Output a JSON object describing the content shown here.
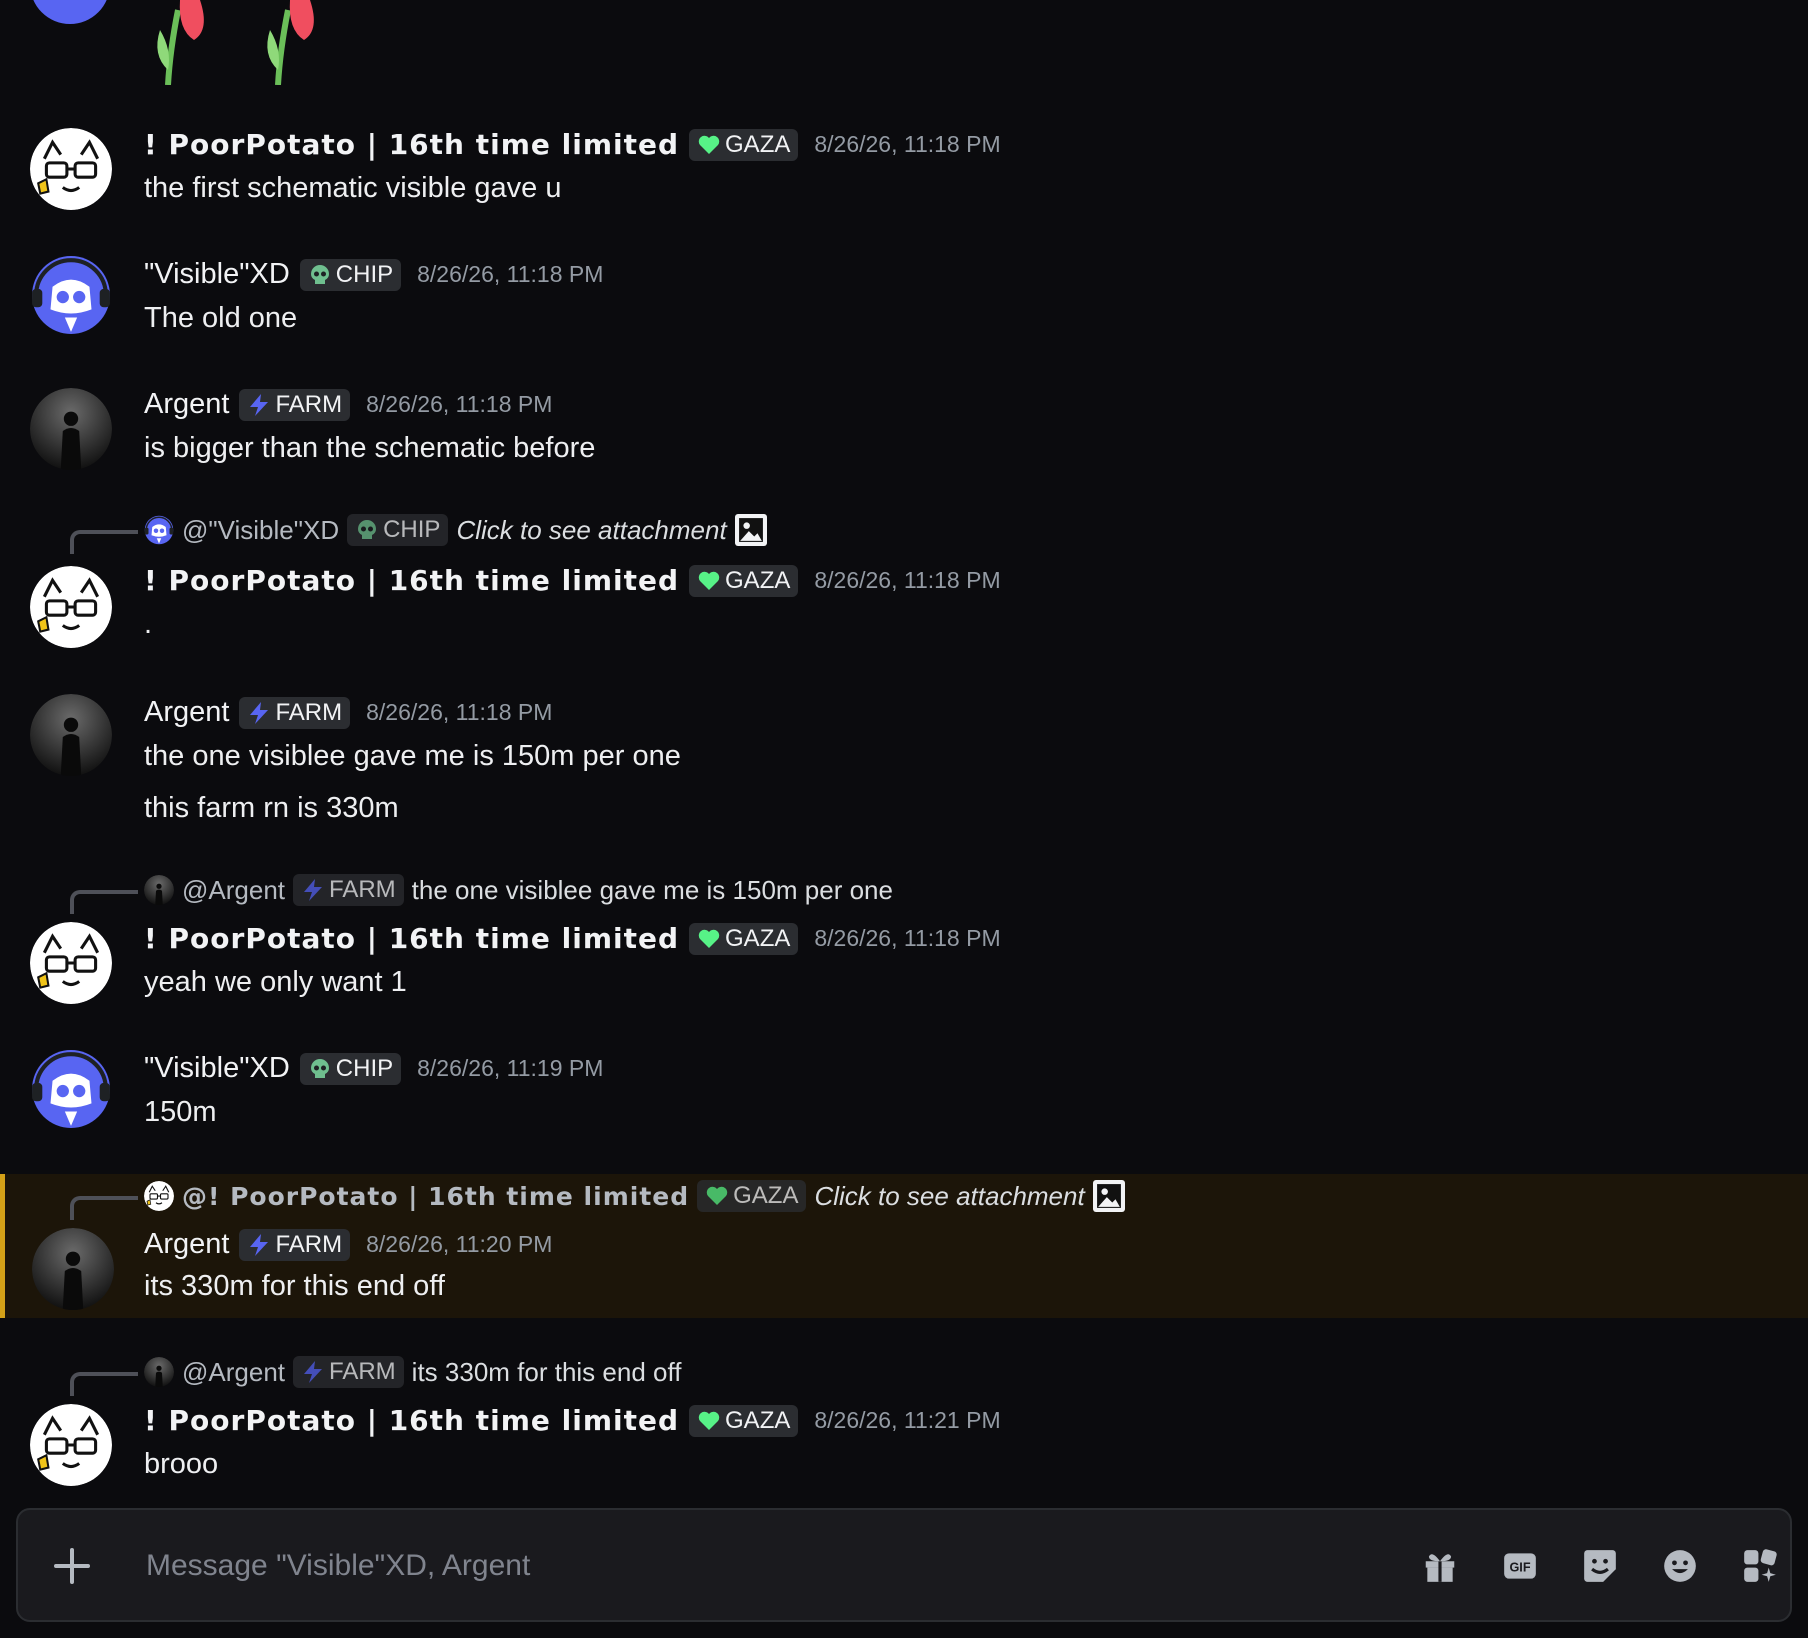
{
  "users": {
    "potato": "! PoorPotato | 16th time limited",
    "visible": "\"Visible\"XD",
    "argent": "Argent"
  },
  "tags": {
    "gaza": "GAZA",
    "chip": "CHIP",
    "farm": "FARM"
  },
  "messages": [
    {
      "time": "8/26/26, 11:18 PM",
      "text": "the first schematic visible gave u"
    },
    {
      "time": "8/26/26, 11:18 PM",
      "text": "The old one"
    },
    {
      "time": "8/26/26, 11:18 PM",
      "text": "is bigger than the schematic before"
    },
    {
      "reply_user": "@\"Visible\"XD",
      "reply_text": "Click to see attachment",
      "time": "8/26/26, 11:18 PM",
      "text": "."
    },
    {
      "time": "8/26/26, 11:18 PM",
      "text": "the one visiblee gave me is 150m per one",
      "text2": "this farm  rn is 330m"
    },
    {
      "reply_user": "@Argent",
      "reply_text": "the one visiblee gave me is 150m per one",
      "time": "8/26/26, 11:18 PM",
      "text": "yeah we only want 1"
    },
    {
      "time": "8/26/26, 11:19 PM",
      "text": "150m"
    },
    {
      "reply_user": "@! PoorPotato | 16th time limited",
      "reply_text": "Click to see attachment",
      "time": "8/26/26, 11:20 PM",
      "text": "its 330m for this end off"
    },
    {
      "reply_user": "@Argent",
      "reply_text": "its 330m for this end off",
      "time": "8/26/26, 11:21 PM",
      "text": "brooo"
    }
  ],
  "composer": {
    "placeholder": "Message \"Visible\"XD, Argent"
  },
  "icons": {
    "gaza": "green-heart-icon",
    "chip": "skull-icon",
    "farm": "lightning-icon",
    "tools": [
      "gift-icon",
      "gif-icon",
      "sticker-icon",
      "emoji-icon",
      "apps-icon"
    ]
  },
  "colors": {
    "gaza": "#57f287",
    "farm": "#5865f2",
    "highlight": "#d4a118",
    "background": "#0b0b0e"
  }
}
